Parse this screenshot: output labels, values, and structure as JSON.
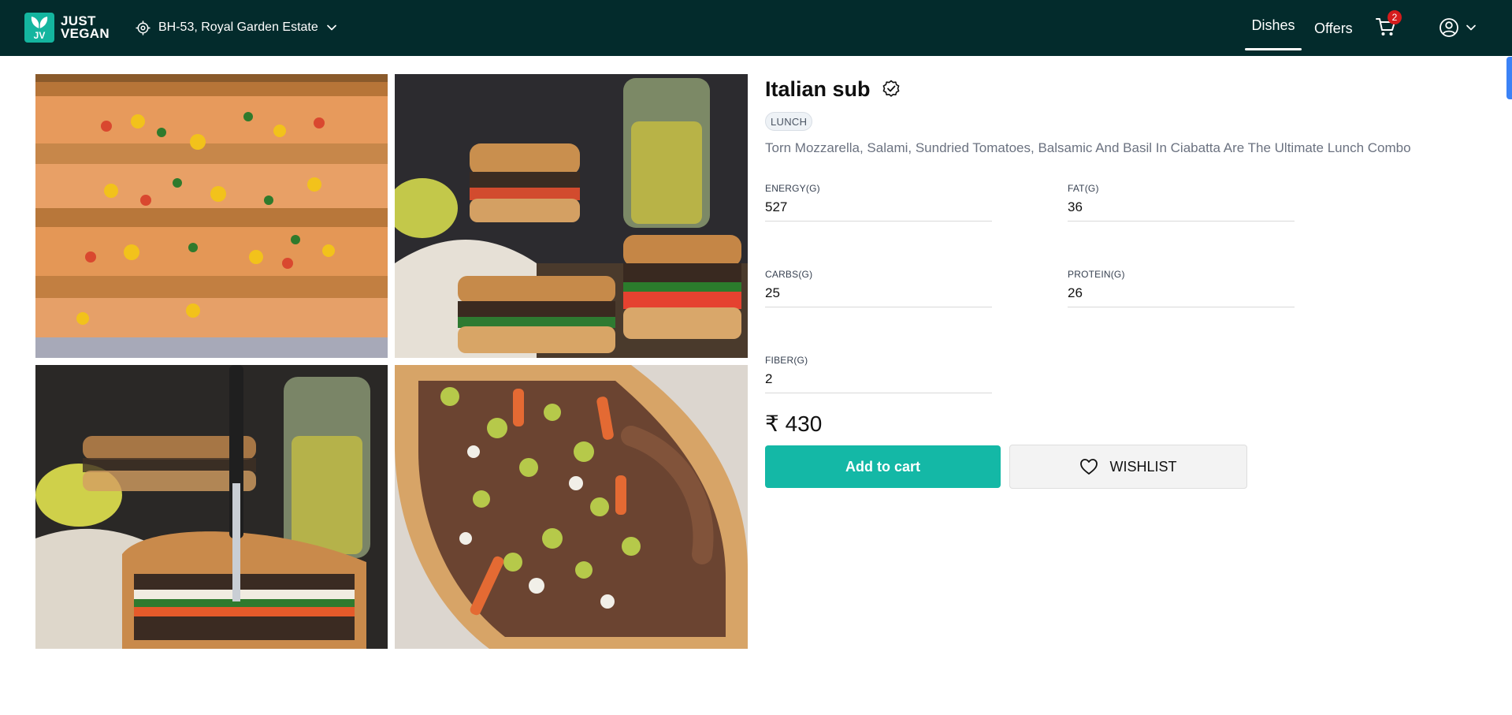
{
  "header": {
    "brand_line1": "JUST",
    "brand_line2": "VEGAN",
    "brand_badge": "JV",
    "location": "BH-53, Royal Garden Estate",
    "nav": {
      "dishes": "Dishes",
      "offers": "Offers"
    },
    "cart_count": "2",
    "colors": {
      "bar": "#032b2c",
      "badge": "#d51c1c",
      "brand": "#14b59f"
    }
  },
  "gallery": {
    "images": [
      {
        "icon": "grilled-sandwich-stack-photo"
      },
      {
        "icon": "sub-sandwich-with-pickles-photo"
      },
      {
        "icon": "sliced-sub-with-knife-photo"
      },
      {
        "icon": "beef-sub-with-giardiniera-photo"
      }
    ]
  },
  "product": {
    "title": "Italian sub",
    "verified_icon": "verified-check-icon",
    "tag": "LUNCH",
    "description": "Torn Mozzarella, Salami, Sundried Tomatoes, Balsamic And Basil In Ciabatta Are The Ultimate Lunch Combo",
    "nutrition": {
      "energy": {
        "label": "ENERGY(G)",
        "value": "527"
      },
      "fat": {
        "label": "FAT(G)",
        "value": "36"
      },
      "carbs": {
        "label": "CARBS(G)",
        "value": "25"
      },
      "protein": {
        "label": "PROTEIN(G)",
        "value": "26"
      },
      "fiber": {
        "label": "FIBER(G)",
        "value": "2"
      }
    },
    "price": "₹ 430",
    "add_to_cart": "Add to cart",
    "wishlist": "WISHLIST",
    "colors": {
      "accent": "#14b8a6"
    }
  }
}
